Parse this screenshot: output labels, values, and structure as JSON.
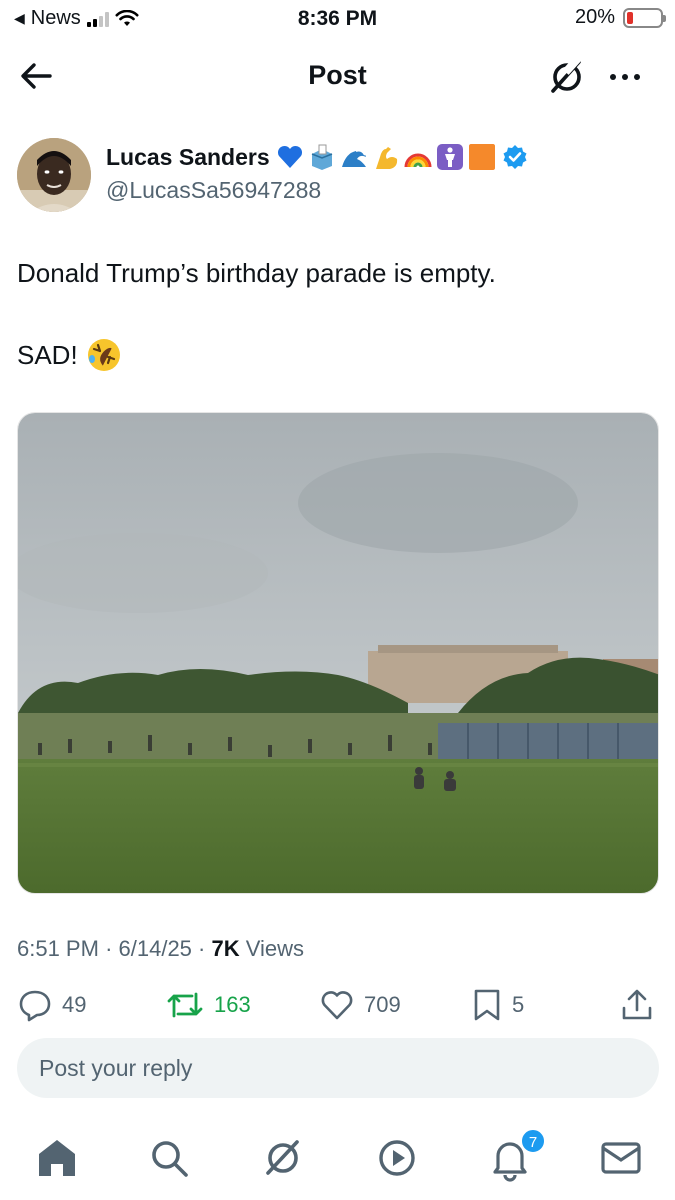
{
  "status_bar": {
    "back_app": "News",
    "time": "8:36 PM",
    "battery": "20%"
  },
  "header": {
    "title": "Post"
  },
  "author": {
    "name": "Lucas Sanders",
    "handle": "@LucasSa56947288",
    "emojis": [
      "blue-heart",
      "ballot-box",
      "water-wave",
      "flexed-biceps",
      "rainbow",
      "person-symbol",
      "orange-square"
    ],
    "verified": true
  },
  "tweet": {
    "line1": "Donald Trump’s birthday parade is empty.",
    "line2": "SAD!",
    "emoji": "rolling-on-floor-laughing"
  },
  "meta": {
    "time": "6:51 PM",
    "date": "6/14/25",
    "views_count": "7K",
    "views_label": "Views"
  },
  "actions": {
    "replies": "49",
    "reposts": "163",
    "likes": "709",
    "bookmarks": "5"
  },
  "reply": {
    "placeholder": "Post your reply"
  },
  "bottom_nav": {
    "notifications_badge": "7"
  },
  "colors": {
    "verified_blue": "#1d9bf0",
    "repost_green": "#17a34a",
    "secondary_text": "#536471"
  }
}
